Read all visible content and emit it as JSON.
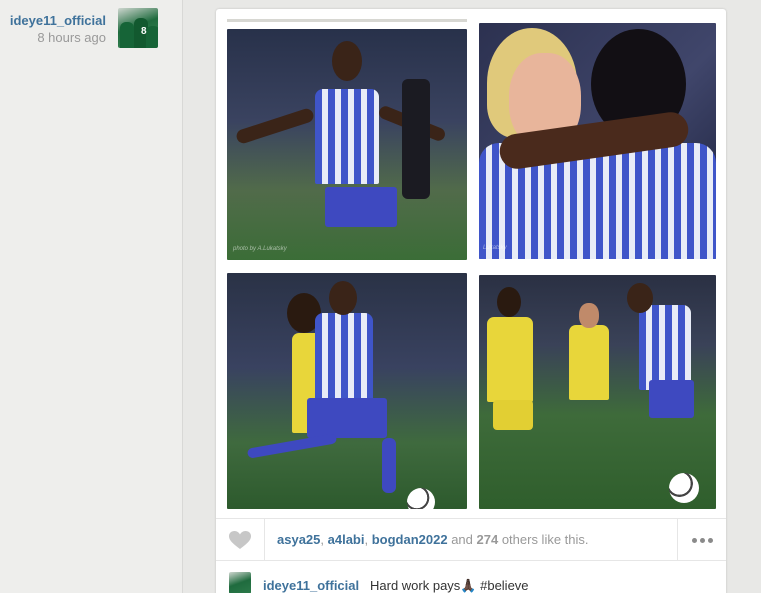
{
  "author": {
    "username": "ideye11_official",
    "time_ago": "8 hours ago",
    "avatar_icon": "avatar-photo"
  },
  "photos": {
    "p1_watermark": "photo by A.Lukatsky",
    "p2_watermark": "Lukatsky"
  },
  "actions": {
    "like_icon": "heart-icon",
    "liker_1": "asya25",
    "sep_1": ", ",
    "liker_2": "a4labi",
    "sep_2": ", ",
    "liker_3": "bogdan2022",
    "and_text": " and ",
    "others_count": "274",
    "others_text": " others like this.",
    "more_icon": "more-icon"
  },
  "comment": {
    "username": "ideye11_official",
    "text": "Hard work pays🙏🏿 #believe"
  },
  "colors": {
    "link": "#3f729b",
    "muted": "#999999",
    "background": "#e8e8e6"
  }
}
